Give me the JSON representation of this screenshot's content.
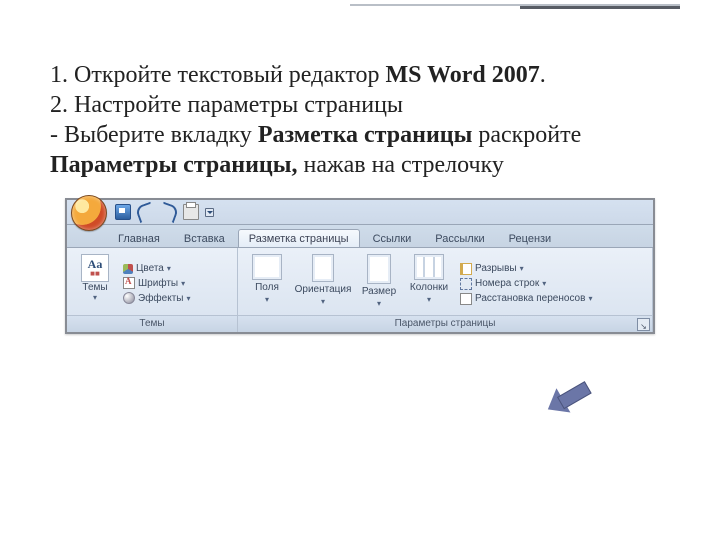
{
  "instructions": {
    "line1_pre": "1. Откройте текстовый редактор ",
    "line1_bold": "MS Word 2007",
    "line1_post": ".",
    "line2": "2. Настройте параметры страницы",
    "line3_pre": "- Выберите вкладку ",
    "line3_b1": "Разметка страницы",
    "line3_mid": " раскройте ",
    "line3_b2": "Параметры страницы,",
    "line3_post": " нажав на стрелочку"
  },
  "qat": {
    "save": "Сохранить",
    "undo": "Отменить",
    "redo": "Вернуть",
    "print": "Быстрая печать",
    "customize": "Настройка панели быстрого доступа"
  },
  "tabs": [
    "Главная",
    "Вставка",
    "Разметка страницы",
    "Ссылки",
    "Рассылки",
    "Рецензи"
  ],
  "active_tab_index": 2,
  "group_themes": {
    "title": "Темы",
    "themes_btn": "Темы",
    "Aa_big": "Aa",
    "colors": "Цвета",
    "fonts": "Шрифты",
    "effects": "Эффекты"
  },
  "group_pagesetup": {
    "title": "Параметры страницы",
    "margins": "Поля",
    "orientation": "Ориентация",
    "size": "Размер",
    "columns": "Колонки",
    "breaks": "Разрывы",
    "line_numbers": "Номера строк",
    "hyphenation": "Расстановка переносов"
  }
}
